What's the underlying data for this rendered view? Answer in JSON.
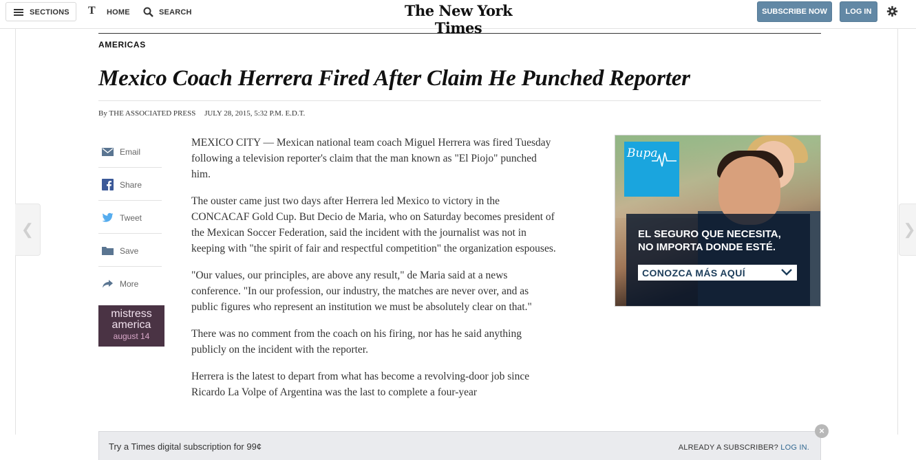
{
  "masthead": {
    "sections_label": "SECTIONS",
    "home_label": "HOME",
    "home_icon": "T",
    "search_label": "SEARCH",
    "logo_text": "The New York Times",
    "subscribe_label": "SUBSCRIBE NOW",
    "login_label": "LOG IN",
    "accent_color": "#6288a5"
  },
  "article": {
    "kicker": "AMERICAS",
    "headline": "Mexico Coach Herrera Fired After Claim He Punched Reporter",
    "byline_prefix": "By",
    "byline_author": "THE ASSOCIATED PRESS",
    "dateline": "JULY 28, 2015, 5:32 P.M. E.D.T.",
    "paragraphs": [
      "MEXICO CITY — Mexican national team coach Miguel Herrera was fired Tuesday following a television reporter's claim that the man known as \"El Piojo\" punched him.",
      "The ouster came just two days after Herrera led Mexico to victory in the CONCACAF Gold Cup. But Decio de Maria, who on Saturday becomes president of the Mexican Soccer Federation, said the incident with the journalist was not in keeping with \"the spirit of fair and respectful competition\" the organization espouses.",
      "\"Our values, our principles, are above any result,\" de Maria said at a news conference. \"In our profession, our industry, the matches are never over, and as public figures who represent an institution we must be absolutely clear on that.\"",
      "There was no comment from the coach on his firing, nor has he said anything publicly on the incident with the reporter.",
      "Herrera is the latest to depart from what has become a revolving-door job since Ricardo La Volpe of Argentina was the last to complete a four-year"
    ]
  },
  "share_tools": {
    "items": [
      {
        "label": "Email",
        "icon": "email-icon"
      },
      {
        "label": "Share",
        "icon": "facebook-icon"
      },
      {
        "label": "Tweet",
        "icon": "twitter-icon"
      },
      {
        "label": "Save",
        "icon": "folder-icon"
      },
      {
        "label": "More",
        "icon": "share-arrow-icon"
      }
    ]
  },
  "small_ad": {
    "line1": "mistress",
    "line2": "america",
    "line3": "august 14"
  },
  "right_ad": {
    "brand": "Bupa",
    "tagline_1": "EL SEGURO QUE NECESITA,",
    "tagline_2": "NO IMPORTA DONDE ESTÉ.",
    "cta": "CONOZCA MÁS AQUÍ",
    "brand_color": "#1aa5de"
  },
  "navigation": {
    "prev_arrow": "❮",
    "next_arrow": "❯"
  },
  "subscription_bar": {
    "offer": "Try a Times digital subscription for 99¢",
    "already_prefix": "ALREADY A SUBSCRIBER?",
    "login_link": "LOG IN.",
    "close_glyph": "×"
  }
}
